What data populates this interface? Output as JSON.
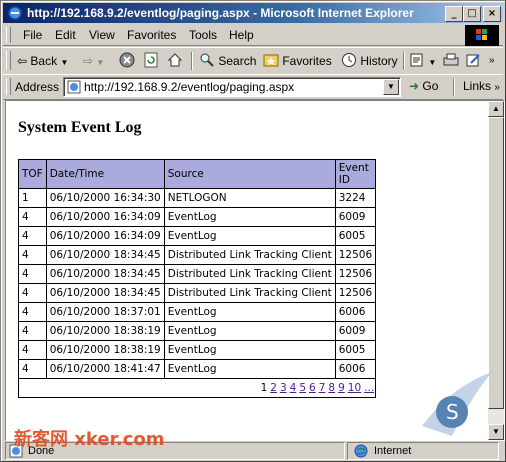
{
  "window": {
    "title": "http://192.168.9.2/eventlog/paging.aspx - Microsoft Internet Explorer",
    "minimize": "_",
    "maximize": "□",
    "close": "×"
  },
  "menu": [
    "File",
    "Edit",
    "View",
    "Favorites",
    "Tools",
    "Help"
  ],
  "toolbar": {
    "back": "Back",
    "search": "Search",
    "favorites": "Favorites",
    "history": "History"
  },
  "address": {
    "label": "Address",
    "url": "http://192.168.9.2/eventlog/paging.aspx",
    "go": "Go",
    "links": "Links"
  },
  "page": {
    "heading": "System Event Log",
    "columns": [
      "TOF",
      "Date/Time",
      "Source",
      "Event ID"
    ],
    "rows": [
      [
        "1",
        "06/10/2000 16:34:30",
        "NETLOGON",
        "3224"
      ],
      [
        "4",
        "06/10/2000 16:34:09",
        "EventLog",
        "6009"
      ],
      [
        "4",
        "06/10/2000 16:34:09",
        "EventLog",
        "6005"
      ],
      [
        "4",
        "06/10/2000 18:34:45",
        "Distributed Link Tracking Client",
        "12506"
      ],
      [
        "4",
        "06/10/2000 18:34:45",
        "Distributed Link Tracking Client",
        "12506"
      ],
      [
        "4",
        "06/10/2000 18:34:45",
        "Distributed Link Tracking Client",
        "12506"
      ],
      [
        "4",
        "06/10/2000 18:37:01",
        "EventLog",
        "6006"
      ],
      [
        "4",
        "06/10/2000 18:38:19",
        "EventLog",
        "6009"
      ],
      [
        "4",
        "06/10/2000 18:38:19",
        "EventLog",
        "6005"
      ],
      [
        "4",
        "06/10/2000 18:41:47",
        "EventLog",
        "6006"
      ]
    ],
    "pager": {
      "current": "1",
      "links": [
        "2",
        "3",
        "4",
        "5",
        "6",
        "7",
        "8",
        "9",
        "10",
        "..."
      ]
    }
  },
  "status": {
    "text": "Done",
    "zone": "Internet"
  },
  "watermark": {
    "text": "新客网 xker.com"
  },
  "colors": {
    "titlebar_start": "#0a246a",
    "titlebar_end": "#a6caf0",
    "header_bg": "#aaaadd",
    "link": "#551a8b"
  }
}
